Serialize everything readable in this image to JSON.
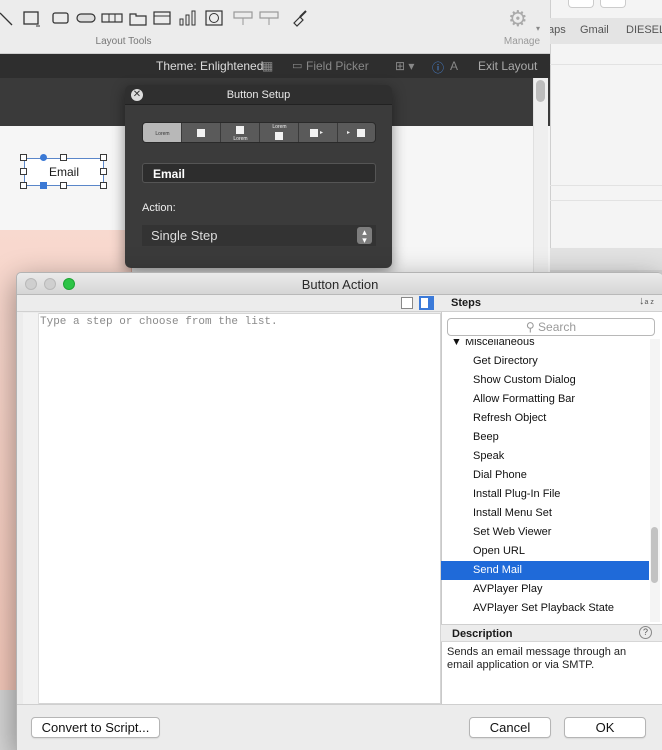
{
  "layout_toolbar": {
    "label": "Layout Tools",
    "manage_label": "Manage",
    "tools": [
      "line-tool-icon",
      "rectangle-tool-icon",
      "rounded-rectangle-tool-icon",
      "oval-button-tool-icon",
      "button-bar-tool-icon",
      "tab-control-tool-icon",
      "slide-control-tool-icon",
      "chart-tool-icon",
      "web-viewer-tool-icon",
      "popover-button-tool-icon",
      "portal-tool-icon",
      "format-painter-icon"
    ]
  },
  "status_bar": {
    "theme_label": "Theme: Enlightened",
    "field_picker": "Field Picker",
    "exit_layout": "Exit Layout"
  },
  "canvas": {
    "button_label": "Email"
  },
  "browser": {
    "tabs": [
      "aps",
      "Gmail",
      "DIESEL"
    ]
  },
  "button_setup": {
    "title": "Button Setup",
    "segments": [
      "Lorem",
      "",
      "Lorem",
      "Lorem",
      "",
      ""
    ],
    "button_name": "Email",
    "action_label": "Action:",
    "action_value": "Single Step"
  },
  "button_action": {
    "title": "Button Action",
    "script_placeholder": "Type a step or choose from the list.",
    "steps_title": "Steps",
    "search_placeholder": "Search",
    "category": "Miscellaneous",
    "steps": [
      "Get Directory",
      "Show Custom Dialog",
      "Allow Formatting Bar",
      "Refresh Object",
      "Beep",
      "Speak",
      "Dial Phone",
      "Install Plug-In File",
      "Install Menu Set",
      "Set Web Viewer",
      "Open URL",
      "Send Mail",
      "AVPlayer Play",
      "AVPlayer Set Playback State"
    ],
    "selected_step": "Send Mail",
    "description_title": "Description",
    "description_text": "Sends an email message through an email application or via SMTP.",
    "convert_button": "Convert to Script...",
    "cancel_button": "Cancel",
    "ok_button": "OK"
  }
}
